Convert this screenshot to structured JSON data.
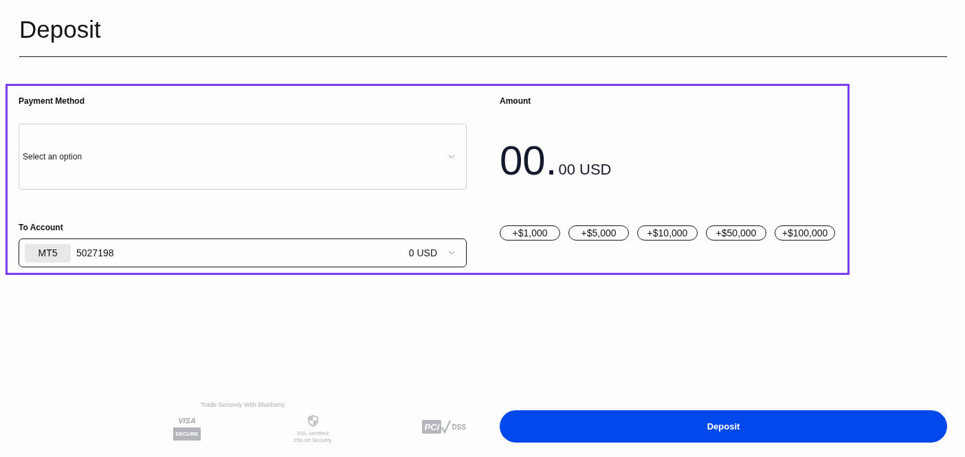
{
  "page": {
    "title": "Deposit"
  },
  "payment_method": {
    "label": "Payment Method",
    "placeholder": "Select an option"
  },
  "to_account": {
    "label": "To Account",
    "platform": "MT5",
    "account_number": "5027198",
    "balance": "0 USD"
  },
  "amount": {
    "label": "Amount",
    "whole": "00.",
    "fraction": "00",
    "currency": "USD",
    "quick_adds": [
      "+$1,000",
      "+$5,000",
      "+$10,000",
      "+$50,000",
      "+$100,000"
    ]
  },
  "security": {
    "title": "Trade Securely With Blueberry",
    "badges": [
      {
        "kind": "visa",
        "lines": [
          "VISA",
          "SECURE"
        ]
      },
      {
        "kind": "ssl",
        "lines": [
          "SSL-certified",
          "256-bit Security"
        ]
      },
      {
        "kind": "pci",
        "lines": [
          "PCi",
          "DSS"
        ]
      }
    ]
  },
  "submit_button": {
    "label": "Deposit"
  }
}
